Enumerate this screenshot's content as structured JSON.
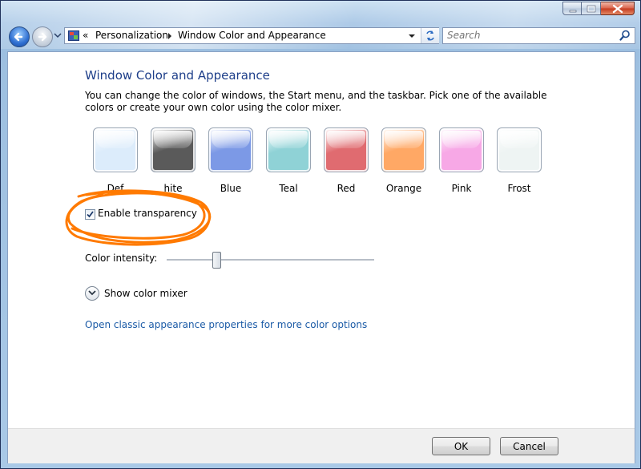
{
  "window": {
    "caption_buttons": [
      "minimize",
      "maximize",
      "close"
    ]
  },
  "address_bar": {
    "overflow_chevron": "«",
    "breadcrumbs": [
      "Personalization",
      "Window Color and Appearance"
    ]
  },
  "search": {
    "placeholder": "Search"
  },
  "content": {
    "title": "Window Color and Appearance",
    "description": "You can change the color of windows, the Start menu, and the taskbar. Pick one of the available colors or create your own color using the color mixer.",
    "swatches": [
      {
        "label": "Def",
        "color": "#dcecfb"
      },
      {
        "label": "hite",
        "color": "#5a5a5a"
      },
      {
        "label": "Blue",
        "color": "#7c99e6"
      },
      {
        "label": "Teal",
        "color": "#8fd2d6"
      },
      {
        "label": "Red",
        "color": "#e06b70"
      },
      {
        "label": "Orange",
        "color": "#ffa865"
      },
      {
        "label": "Pink",
        "color": "#f7a8e6"
      },
      {
        "label": "Frost",
        "color": "#eef4f3"
      }
    ],
    "transparency": {
      "label": "Enable transparency",
      "checked": true
    },
    "annotation_color": "#ff7a00",
    "intensity": {
      "label": "Color intensity:",
      "value_fraction": 0.24
    },
    "mixer": {
      "label": "Show color mixer"
    },
    "classic_link": "Open classic appearance properties for more color options"
  },
  "footer": {
    "ok_label": "OK",
    "cancel_label": "Cancel"
  }
}
